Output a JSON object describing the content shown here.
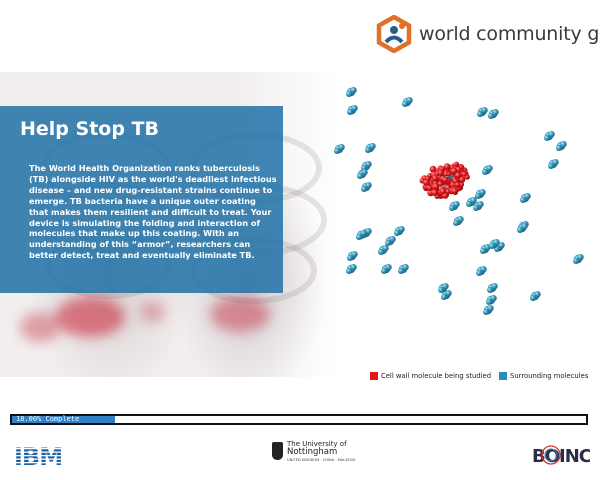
{
  "header": {
    "brand_text": "world community grid",
    "logo_icon": "hexagon-people-icon",
    "colors": {
      "orange": "#e0702a",
      "blue": "#2a5b8c"
    }
  },
  "panel": {
    "title": "Help Stop TB",
    "body": "The World Health Organization ranks tuberculosis (TB) alongside HIV as the world's deadliest infectious disease – and new drug-resistant strains continue to emerge. TB bacteria have a unique outer coating that makes them resilient and difficult to treat. Your device is simulating the folding and interaction of molecules that make up this coating. With an understanding of this “armor”, researchers can better detect, treat and eventually eliminate TB.",
    "background": "#2674a8"
  },
  "legend": {
    "items": [
      {
        "label": "Cell wall molecule being studied",
        "color": "#e8141b"
      },
      {
        "label": "Surrounding molecules",
        "color": "#2a8fb0"
      }
    ]
  },
  "progress": {
    "text": "18.00% Complete",
    "percent": 18
  },
  "footer": {
    "ibm": "IBM",
    "nottingham_line1": "The University of",
    "nottingham_line2": "Nottingham",
    "nottingham_line3": "UNITED KINGDOM · CHINA · MALAYSIA",
    "boinc": "BOINC"
  }
}
